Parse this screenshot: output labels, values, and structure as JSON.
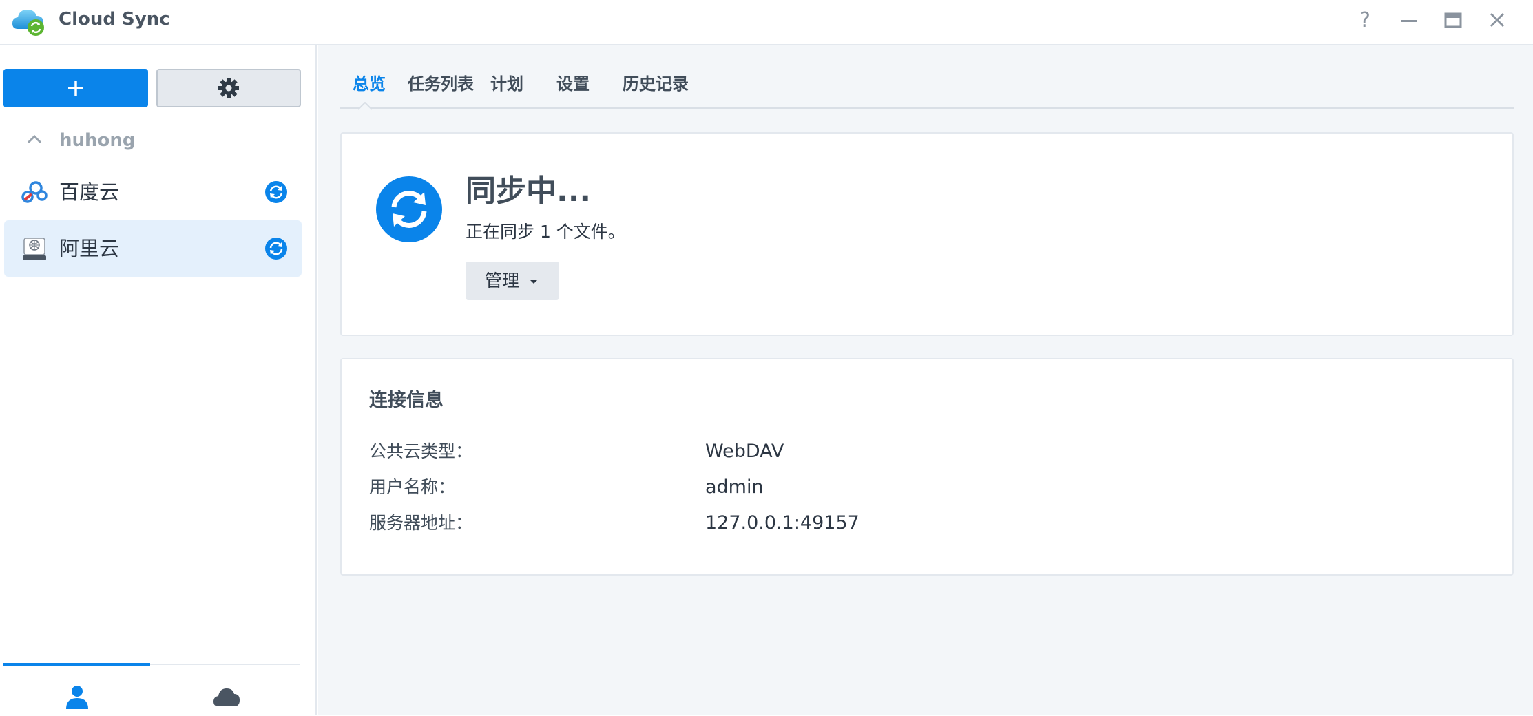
{
  "window": {
    "title": "Cloud Sync",
    "help_glyph": "?"
  },
  "sidebar": {
    "group": "huhong",
    "tasks": [
      {
        "label": "百度云",
        "icon": "baidu-cloud-icon",
        "status_icon": "syncing-icon",
        "active": false
      },
      {
        "label": "阿里云",
        "icon": "webdav-server-icon",
        "status_icon": "syncing-icon",
        "active": true
      }
    ],
    "bottom_tabs": [
      {
        "icon": "user-icon",
        "active": true
      },
      {
        "icon": "cloud-icon",
        "active": false
      }
    ]
  },
  "tabs": [
    "总览",
    "任务列表",
    "计划",
    "设置",
    "历史记录"
  ],
  "active_tab": "总览",
  "status": {
    "title": "同步中...",
    "subtitle": "正在同步 1 个文件。",
    "manage_label": "管理"
  },
  "connection": {
    "title": "连接信息",
    "rows": [
      {
        "key": "公共云类型：",
        "value": "WebDAV"
      },
      {
        "key": "用户名称：",
        "value": "admin"
      },
      {
        "key": "服务器地址：",
        "value": "127.0.0.1:49157"
      }
    ]
  },
  "colors": {
    "accent": "#0a84ea",
    "active_item_bg": "#e4f0fc",
    "main_bg": "#f3f6f9"
  }
}
